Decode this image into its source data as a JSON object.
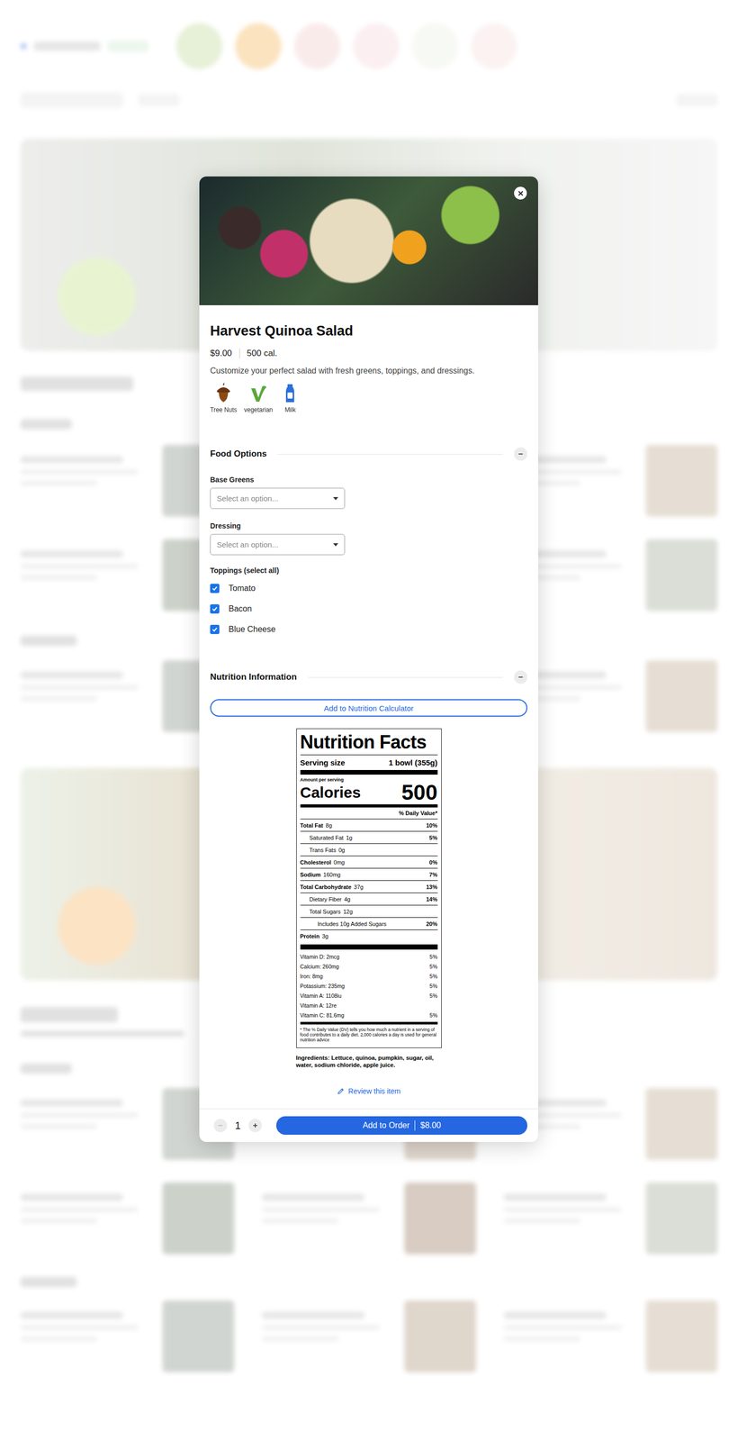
{
  "item": {
    "title": "Harvest Quinoa Salad",
    "price": "$9.00",
    "calories": "500 cal.",
    "description": "Customize your perfect salad with fresh greens, toppings, and dressings."
  },
  "allergens": [
    {
      "label": "Tree Nuts",
      "kind": "nut",
      "color": "#8a4a14"
    },
    {
      "label": "vegetarian",
      "kind": "leaf",
      "color": "#5aa83a"
    },
    {
      "label": "Milk",
      "kind": "bottle",
      "color": "#2a6fdb"
    }
  ],
  "food_options": {
    "heading": "Food Options",
    "expanded": true,
    "selects": [
      {
        "label": "Base Greens",
        "placeholder": "Select an option..."
      },
      {
        "label": "Dressing",
        "placeholder": "Select an option..."
      }
    ],
    "toppings": {
      "label": "Toppings (select all)",
      "items": [
        {
          "label": "Tomato",
          "checked": true
        },
        {
          "label": "Bacon",
          "checked": true
        },
        {
          "label": "Blue Cheese",
          "checked": true
        }
      ]
    }
  },
  "nutrition": {
    "heading": "Nutrition Information",
    "expanded": true,
    "calculator_button": "Add to Nutrition Calculator",
    "facts": {
      "title": "Nutrition Facts",
      "serving_label": "Serving size",
      "serving_value": "1 bowl (355g)",
      "amount_label": "Amount per serving",
      "calories_label": "Calories",
      "calories_value": "500",
      "dv_header": "% Daily Value*",
      "nutrients": [
        {
          "name": "Total Fat",
          "amount": "8g",
          "dv": "10%",
          "kind": "main"
        },
        {
          "name": "Saturated Fat",
          "amount": "1g",
          "dv": "5%",
          "kind": "sub"
        },
        {
          "name": "Trans Fats",
          "amount": "0g",
          "kind": "sub"
        },
        {
          "name": "Cholesterol",
          "amount": "0mg",
          "dv": "0%",
          "kind": "main"
        },
        {
          "name": "Sodium",
          "amount": "160mg",
          "dv": "7%",
          "kind": "main"
        },
        {
          "name": "Total Carbohydrate",
          "amount": "37g",
          "dv": "13%",
          "kind": "main"
        },
        {
          "name": "Dietary Fiber",
          "amount": "4g",
          "dv": "14%",
          "kind": "sub"
        },
        {
          "name": "Total Sugars",
          "amount": "12g",
          "kind": "sub"
        },
        {
          "name": "Includes 10g Added Sugars",
          "amount": "",
          "dv": "20%",
          "kind": "subsub"
        },
        {
          "name": "Protein",
          "amount": "3g",
          "kind": "main"
        }
      ],
      "vitamins": [
        {
          "label": "Vitamin D: 2mcg",
          "dv": "5%"
        },
        {
          "label": "Calcium: 260mg",
          "dv": "5%"
        },
        {
          "label": "Iron: 8mg",
          "dv": "5%"
        },
        {
          "label": "Potassium: 235mg",
          "dv": "5%"
        },
        {
          "label": "Vitamin A: 1108iu",
          "dv": "5%"
        },
        {
          "label": "Vitamin A: 12re"
        },
        {
          "label": "Vitamin C: 81.6mg",
          "dv": "5%"
        }
      ],
      "footnote": "* The % Daily Value (DV) tells you how much a nutrient in a serving of food contributes to a daily diet. 2,000 calories a day is used for general nutrition advice"
    },
    "ingredients": "Ingredients: Lettuce, quinoa, pumpkin, sugar, oil, water, sodium chloride, apple juice."
  },
  "review_link": "Review this item",
  "footer": {
    "quantity": "1",
    "decrease_disabled": true,
    "add_button": "Add to Order",
    "total": "$8.00"
  }
}
